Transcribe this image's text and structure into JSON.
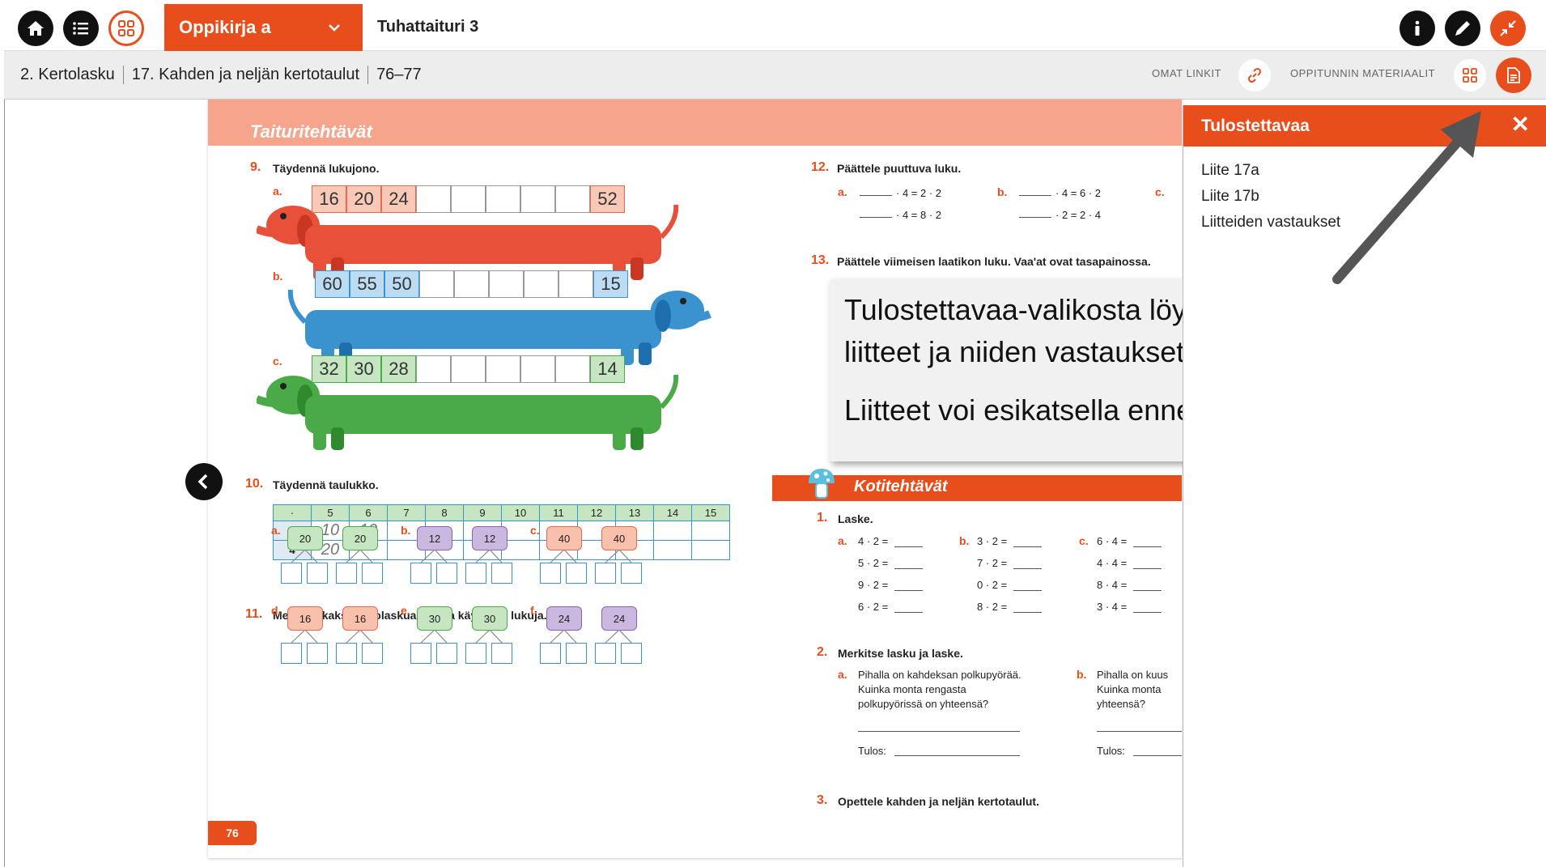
{
  "topbar": {
    "book_select_label": "Oppikirja a",
    "book_title": "Tuhattaituri 3"
  },
  "breadcrumb": {
    "items": [
      "2. Kertolasku",
      "17. Kahden ja neljän kertotaulut",
      "76–77"
    ],
    "own_links": "OMAT LINKIT",
    "lesson_materials": "OPPITUNNIN MATERIAALIT"
  },
  "page": {
    "header": "Taituritehtävät",
    "task9": {
      "num": "9.",
      "text": "Täydennä lukujono.",
      "a": "a.",
      "b": "b.",
      "c": "c.",
      "rows": [
        [
          "16",
          "20",
          "24",
          "",
          "",
          "",
          "",
          "",
          "52"
        ],
        [
          "60",
          "55",
          "50",
          "",
          "",
          "",
          "",
          "",
          "15"
        ],
        [
          "32",
          "30",
          "28",
          "",
          "",
          "",
          "",
          "",
          "14"
        ]
      ]
    },
    "task10": {
      "num": "10.",
      "text": "Täydennä taulukko.",
      "header": [
        "·",
        "5",
        "6",
        "7",
        "8",
        "9",
        "10",
        "11",
        "12",
        "13",
        "14",
        "15"
      ],
      "row2": [
        "2",
        "10",
        "12",
        "",
        "",
        "",
        "",
        "",
        "",
        "",
        "",
        ""
      ],
      "row4": [
        "4",
        "20",
        "",
        "",
        "",
        "",
        "",
        "",
        "",
        "",
        "",
        ""
      ]
    },
    "task11": {
      "num": "11.",
      "text": "Merkitse kaksi kertolaskua, joissa käytät eri lukuja.",
      "groups": [
        {
          "l": "a.",
          "v": "20",
          "c": "green"
        },
        {
          "l": "b.",
          "v": "12",
          "c": "purple"
        },
        {
          "l": "c.",
          "v": "40",
          "c": "red"
        },
        {
          "l": "d.",
          "v": "16",
          "c": "red"
        },
        {
          "l": "e.",
          "v": "30",
          "c": "green"
        },
        {
          "l": "f.",
          "v": "24",
          "c": "purple"
        }
      ]
    },
    "page_number": "76",
    "task12": {
      "num": "12.",
      "text": "Päättele puuttuva luku.",
      "a": "a.",
      "b": "b.",
      "c": "c.",
      "a1": "· 4 = 2 · 2",
      "a2": "· 4 = 8 · 2",
      "b1": "· 4 = 6 · 2",
      "b2": "· 2 = 2 · 4"
    },
    "task13": {
      "num": "13.",
      "text": "Päättele viimeisen laatikon luku. Vaa'at ovat tasapainossa."
    },
    "home_header": "Kotitehtävät",
    "home1": {
      "num": "1.",
      "text": "Laske.",
      "a_label": "a.",
      "b_label": "b.",
      "c_label": "c.",
      "a": [
        "4 · 2 =",
        "5 · 2 =",
        "9 · 2 =",
        "6 · 2 ="
      ],
      "b": [
        "3 · 2 =",
        "7 · 2 =",
        "0 · 2 =",
        "8 · 2 ="
      ],
      "c": [
        "6 · 4 =",
        "4 · 4 =",
        "8 · 4 =",
        "3 · 4 ="
      ]
    },
    "home2": {
      "num": "2.",
      "text": "Merkitse lasku ja laske.",
      "a_label": "a.",
      "b_label": "b.",
      "a_l1": "Pihalla on kahdeksan polkupyörää.",
      "a_l2": "Kuinka monta rengasta",
      "a_l3": "polkupyörissä on yhteensä?",
      "b_l1": "Pihalla on kuus",
      "b_l2": "Kuinka monta",
      "b_l3": "yhteensä?",
      "result": "Tulos:"
    },
    "home3": {
      "num": "3.",
      "text": "Opettele kahden ja neljän kertotaulut."
    }
  },
  "popup": {
    "line1": "Tulostettavaa-valikosta löydät oppitunnin",
    "line2": "liitteet ja niiden vastaukset.",
    "line3": "Liitteet voi esikatsella ennen tulostamista."
  },
  "panel": {
    "title": "Tulostettavaa",
    "items": [
      "Liite 17a",
      "Liite 17b",
      "Liitteiden vastaukset"
    ]
  },
  "colors": {
    "accent": "#e84e1b",
    "header_salmon": "#f6a48c",
    "blue": "#3a92cf",
    "green": "#4aaa48"
  }
}
